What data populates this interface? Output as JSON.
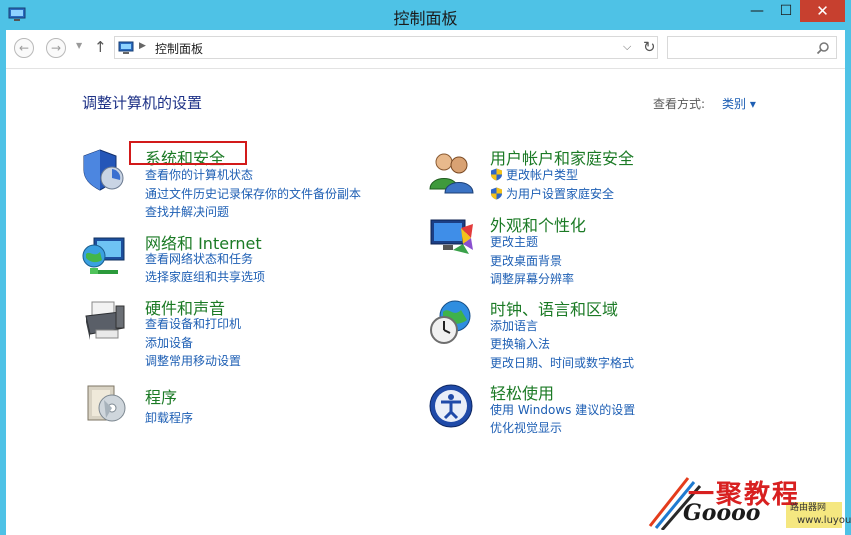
{
  "window": {
    "title": "控制面板",
    "minimize_glyph": "—",
    "maximize_glyph": "☐",
    "close_glyph": "✕"
  },
  "nav": {
    "back_glyph": "←",
    "forward_glyph": "→",
    "recent_glyph": "▼",
    "up_glyph": "↑",
    "address": "控制面板",
    "address_sep": "▶",
    "dropdown_glyph": "⌵",
    "refresh_glyph": "↻",
    "search_placeholder": ""
  },
  "main": {
    "heading": "调整计算机的设置",
    "view_by_label": "查看方式:",
    "view_by_value": "类别 ▾"
  },
  "categories_left": [
    {
      "title": "系统和安全",
      "icon": "shield-icon",
      "links": [
        "查看你的计算机状态",
        "通过文件历史记录保存你的文件备份副本",
        "查找并解决问题"
      ]
    },
    {
      "title": "网络和 Internet",
      "icon": "network-globe-icon",
      "links": [
        "查看网络状态和任务",
        "选择家庭组和共享选项"
      ]
    },
    {
      "title": "硬件和声音",
      "icon": "printer-icon",
      "links": [
        "查看设备和打印机",
        "添加设备",
        "调整常用移动设置"
      ]
    },
    {
      "title": "程序",
      "icon": "programs-icon",
      "links": [
        "卸载程序"
      ]
    }
  ],
  "categories_right": [
    {
      "title": "用户帐户和家庭安全",
      "icon": "users-icon",
      "links": [
        "更改帐户类型",
        "为用户设置家庭安全"
      ]
    },
    {
      "title": "外观和个性化",
      "icon": "appearance-icon",
      "links": [
        "更改主题",
        "更改桌面背景",
        "调整屏幕分辨率"
      ]
    },
    {
      "title": "时钟、语言和区域",
      "icon": "clock-globe-icon",
      "links": [
        "添加语言",
        "更换输入法",
        "更改日期、时间或数字格式"
      ]
    },
    {
      "title": "轻松使用",
      "icon": "ease-of-access-icon",
      "links": [
        "使用 Windows 建议的设置",
        "优化视觉显示"
      ]
    }
  ],
  "watermark": {
    "brand": "一聚教程",
    "site_cn": "路由器网",
    "gooo": "Goooo",
    "domain": "www.luyouqi.com"
  },
  "colors": {
    "titlebar": "#4ec2e6",
    "category_title": "#1b7a25",
    "link": "#1e5fb4",
    "heading": "#1e3287",
    "highlight": "#d21a1a"
  }
}
